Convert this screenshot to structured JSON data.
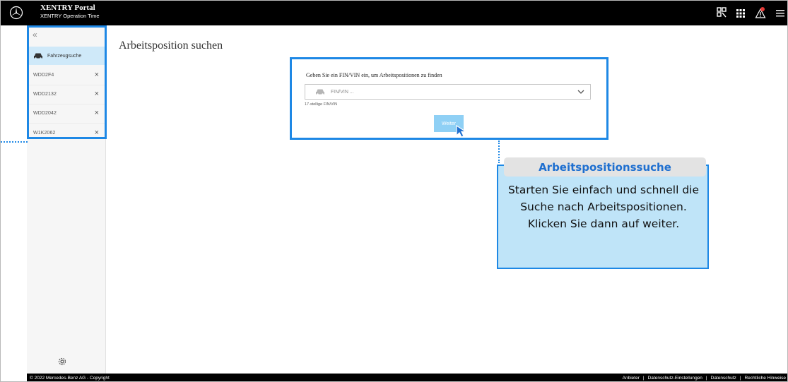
{
  "header": {
    "brand_title": "XENTRY Portal",
    "brand_subtitle": "XENTRY Operation Time",
    "icons": [
      "qr-scan-icon",
      "grid-apps-icon",
      "alert-triangle-icon",
      "menu-icon"
    ]
  },
  "sidebar": {
    "collapse_icon": "double-chevron-left-icon",
    "vehicle_search_label": "Fahrzeugsuche",
    "vins": [
      {
        "vin": "WDD2F4"
      },
      {
        "vin": "WDD2132"
      },
      {
        "vin": "WDD2042"
      },
      {
        "vin": "W1K2062"
      }
    ],
    "settings_icon": "gear-icon"
  },
  "main": {
    "page_title": "Arbeitsposition suchen",
    "card": {
      "instruction": "Geben Sie ein FIN/VIN ein, um Arbeitspositionen zu finden",
      "vin_placeholder": "FIN/VIN ...",
      "helper_text": "17-stellige FIN/VIN",
      "continue_label": "Weiter"
    }
  },
  "callout": {
    "title": "Arbeitspositionssuche",
    "body": "Starten Sie einfach und schnell die Suche nach Arbeitspositionen. Klicken Sie dann auf weiter."
  },
  "footer": {
    "copyright": "© 2022 Mercedes-Benz AG - Copyright",
    "links": [
      "Anbieter",
      "Datenschutz-Einstellungen",
      "Datenschutz",
      "Rechtliche Hinweise"
    ]
  },
  "colors": {
    "highlight": "#1e88e5",
    "callout_bg": "#bfe4f8",
    "active_nav_bg": "#cfe9f9",
    "button_bg": "#8fd0f5"
  }
}
